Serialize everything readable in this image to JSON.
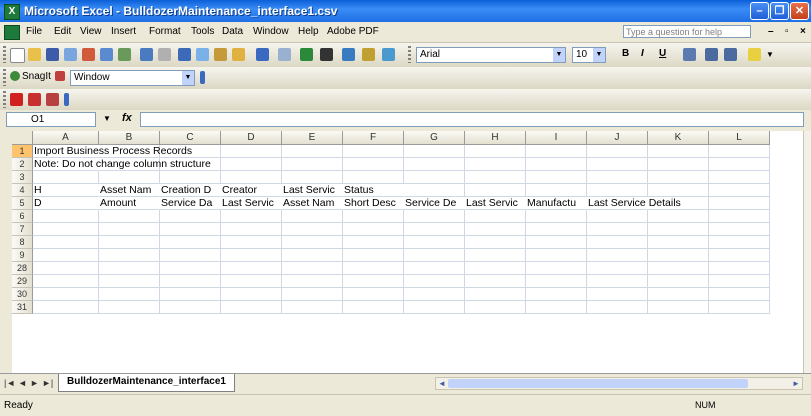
{
  "window": {
    "title": "Microsoft Excel - BulldozerMaintenance_interface1.csv",
    "minimize": "–",
    "restore": "❐",
    "close": "✕"
  },
  "menu": {
    "items": [
      "File",
      "Edit",
      "View",
      "Insert",
      "Format",
      "Tools",
      "Data",
      "Window",
      "Help",
      "Adobe PDF"
    ],
    "help_placeholder": "Type a question for help"
  },
  "toolbar": {
    "font_name": "Arial",
    "font_size": "10",
    "bold": "B",
    "italic": "I",
    "underline": "U",
    "snagit": "SnagIt",
    "snagit_window": "Window"
  },
  "formula_bar": {
    "name_box": "O1",
    "fx": "fx",
    "formula": ""
  },
  "grid": {
    "columns": [
      "A",
      "B",
      "C",
      "D",
      "E",
      "F",
      "G",
      "H",
      "I",
      "J",
      "K",
      "L"
    ],
    "rows": [
      "1",
      "2",
      "3",
      "4",
      "5",
      "6",
      "7",
      "8",
      "9",
      "28",
      "29",
      "30",
      "31"
    ],
    "selected_row": "1",
    "cells": {
      "r1": {
        "A": "Import Business Process Records"
      },
      "r2": {
        "A": "Note: Do not change column structure"
      },
      "r4": {
        "A": "H",
        "B": "Asset Nam",
        "C": "Creation D",
        "D": "Creator",
        "E": "Last Servic",
        "F": "Status"
      },
      "r5": {
        "A": "D",
        "B": "Amount",
        "C": "Service Da",
        "D": "Last Servic",
        "E": "Asset Nam",
        "F": "Short Desc",
        "G": "Service De",
        "H": "Last Servic",
        "I": "Manufactu",
        "J": "Last Service Details"
      }
    }
  },
  "sheet_tabs": {
    "nav": [
      "|◄",
      "◄",
      "►",
      "►|"
    ],
    "active": "BulldozerMaintenance_interface1"
  },
  "status": {
    "text": "Ready",
    "num": "NUM"
  }
}
